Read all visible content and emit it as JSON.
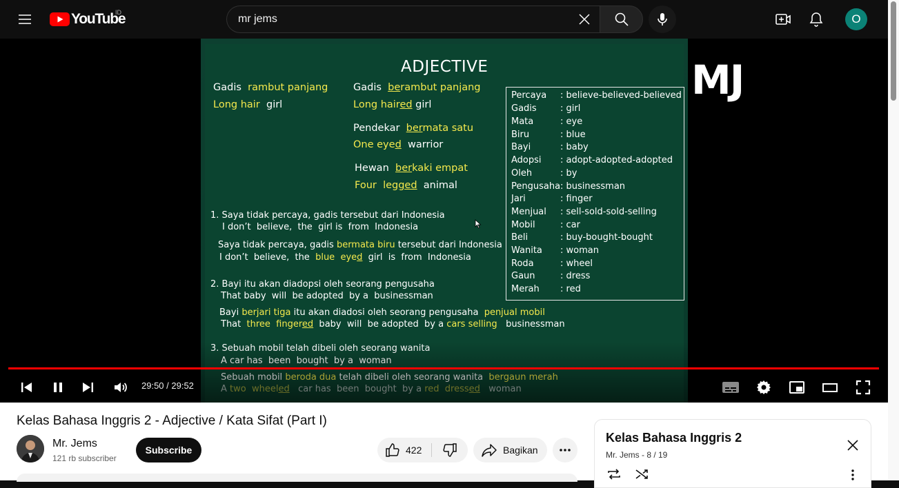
{
  "header": {
    "logo_text": "YouTube",
    "country_code": "ID",
    "search_value": "mr jems",
    "avatar_letter": "O",
    "avatar_color": "#0b8276"
  },
  "player": {
    "time_display": "29:50 / 29:52",
    "progress": 0.999,
    "progress_color": "#ff0000",
    "slide": {
      "title": "ADJECTIVE",
      "watermark": "MJ",
      "vocab": [
        {
          "word": "Percaya",
          "meaning": ": believe-believed-believed"
        },
        {
          "word": "Gadis",
          "meaning": ": girl"
        },
        {
          "word": "Mata",
          "meaning": ": eye"
        },
        {
          "word": "Biru",
          "meaning": ": blue"
        },
        {
          "word": "Bayi",
          "meaning": ": baby"
        },
        {
          "word": "Adopsi",
          "meaning": ": adopt-adopted-adopted"
        },
        {
          "word": "Oleh",
          "meaning": ": by"
        },
        {
          "word": "Pengusaha",
          "meaning": ": businessman"
        },
        {
          "word": "Jari",
          "meaning": ": finger"
        },
        {
          "word": "Menjual",
          "meaning": ": sell-sold-sold-selling"
        },
        {
          "word": "Mobil",
          "meaning": ": car"
        },
        {
          "word": "Beli",
          "meaning": ": buy-bought-bought"
        },
        {
          "word": "Wanita",
          "meaning": ": woman"
        },
        {
          "word": "Roda",
          "meaning": ": wheel"
        },
        {
          "word": "Gaun",
          "meaning": ": dress"
        },
        {
          "word": "Merah",
          "meaning": ": red"
        }
      ]
    }
  },
  "video": {
    "title": "Kelas Bahasa Inggris 2 - Adjective / Kata Sifat (Part I)",
    "channel_name": "Mr. Jems",
    "subscribers": "121 rb subscriber",
    "subscribe_label": "Subscribe",
    "like_count": "422",
    "share_label": "Bagikan"
  },
  "playlist": {
    "title": "Kelas Bahasa Inggris 2",
    "subtitle": "Mr. Jems - 8 / 19"
  }
}
